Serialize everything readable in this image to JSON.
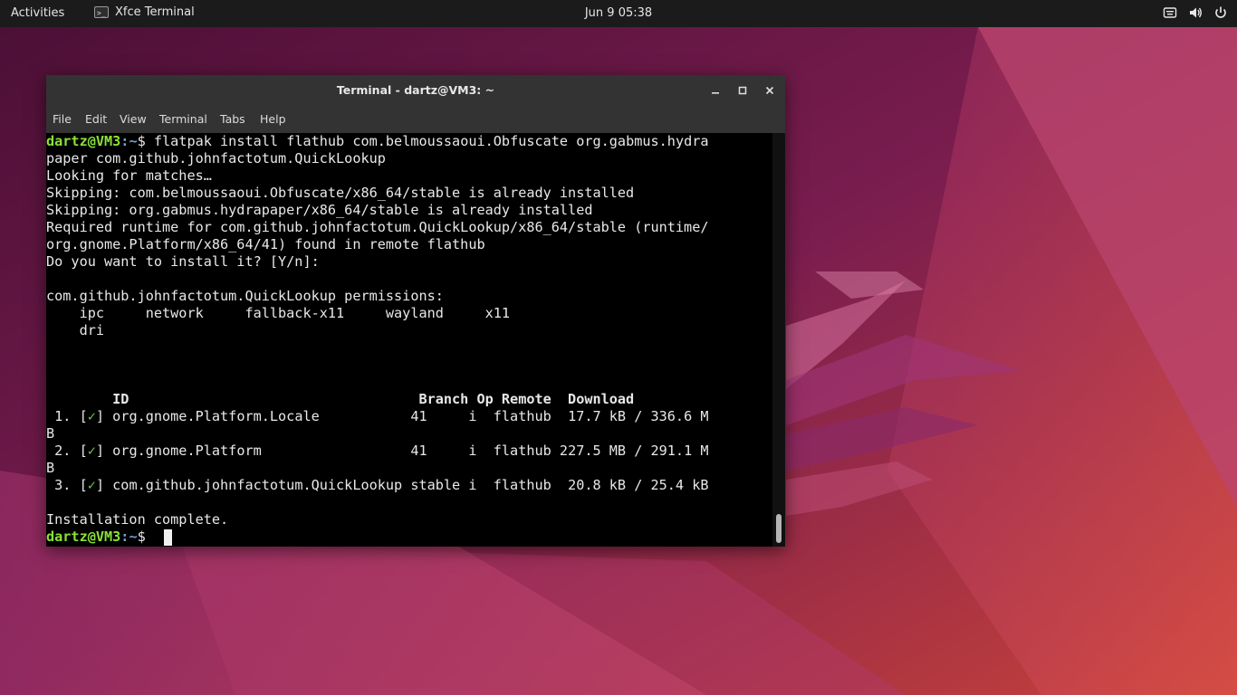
{
  "topbar": {
    "activities": "Activities",
    "app_name": "Xfce Terminal",
    "app_icon": "terminal-icon",
    "app_icon_glyph": ">_",
    "clock": "Jun 9  05:38",
    "tray_icons": [
      "keyboard-icon",
      "volume-icon",
      "power-icon"
    ]
  },
  "window": {
    "title": "Terminal - dartz@VM3: ~",
    "buttons": [
      "minimize-icon",
      "maximize-icon",
      "close-icon"
    ],
    "menu": [
      "File",
      "Edit",
      "View",
      "Terminal",
      "Tabs",
      "Help"
    ]
  },
  "terminal": {
    "prompt_user": "dartz@VM3",
    "prompt_path": ":~",
    "prompt_symbol": "$ ",
    "command": "flatpak install flathub com.belmoussaoui.Obfuscate org.gabmus.hydra",
    "command_wrap": "paper com.github.johnfactotum.QuickLookup",
    "output": [
      "Looking for matches…",
      "Skipping: com.belmoussaoui.Obfuscate/x86_64/stable is already installed",
      "Skipping: org.gabmus.hydrapaper/x86_64/stable is already installed",
      "Required runtime for com.github.johnfactotum.QuickLookup/x86_64/stable (runtime/",
      "org.gnome.Platform/x86_64/41) found in remote flathub",
      "Do you want to install it? [Y/n]:",
      "com.github.johnfactotum.QuickLookup permissions:",
      "    ipc     network     fallback-x11     wayland     x11",
      "    dri"
    ],
    "table_header": "        ID                                   Branch Op Remote  Download",
    "rows": [
      {
        "prefix": " 1. [",
        "check": "✓",
        "rest": "] org.gnome.Platform.Locale           41     i  flathub  17.7 kB / 336.6 M",
        "wrap": "B"
      },
      {
        "prefix": " 2. [",
        "check": "✓",
        "rest": "] org.gnome.Platform                  41     i  flathub 227.5 MB / 291.1 M",
        "wrap": "B"
      },
      {
        "prefix": " 3. [",
        "check": "✓",
        "rest": "] com.github.johnfactotum.QuickLookup stable i  flathub  20.8 kB / 25.4 kB",
        "wrap": ""
      }
    ],
    "complete": "Installation complete."
  },
  "colors": {
    "prompt": "#8ae234",
    "path": "#729fcf",
    "check": "#6cc24a"
  }
}
